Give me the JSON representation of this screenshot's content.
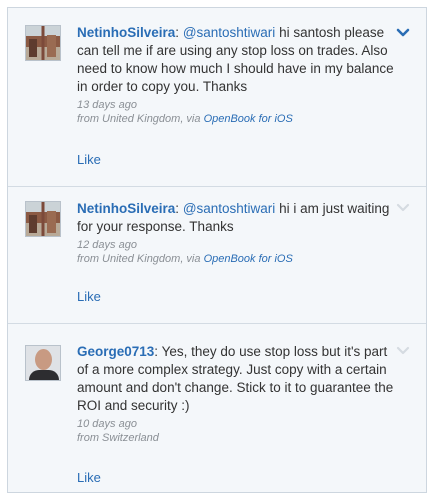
{
  "posts": [
    {
      "author": "NetinhoSilveira",
      "separator": ":",
      "mention": "@santoshtiwari",
      "text": " hi santosh please can tell me if are using any stop loss on trades. Also need to know how much I should have in my balance in order to copy you. Thanks",
      "time": "13 days ago",
      "location": "from United Kingdom, via ",
      "via": "OpenBook for iOS",
      "like_label": "Like",
      "avatar": "street-photo",
      "chevron_active": true
    },
    {
      "author": "NetinhoSilveira",
      "separator": ":",
      "mention": "@santoshtiwari",
      "text": " hi i am just waiting for your response. Thanks",
      "time": "12 days ago",
      "location": "from United Kingdom, via ",
      "via": "OpenBook for iOS",
      "like_label": "Like",
      "avatar": "street-photo",
      "chevron_active": false
    },
    {
      "author": "George0713",
      "separator": ":",
      "text": " Yes, they do use stop loss but it's part of a more complex strategy. Just copy with a certain amount and don't change. Stick to it to guarantee the ROI and security :)",
      "time": "10 days ago",
      "location": "from Switzerland",
      "like_label": "Like",
      "avatar": "face-photo",
      "chevron_active": false
    }
  ],
  "colors": {
    "link": "#2a6db5",
    "text": "#333333",
    "meta": "#8a8f95",
    "chevron_active": "#2a6db5",
    "chevron_inactive": "#d5dbe1"
  },
  "icons": {
    "menu": "chevron-down-icon"
  }
}
